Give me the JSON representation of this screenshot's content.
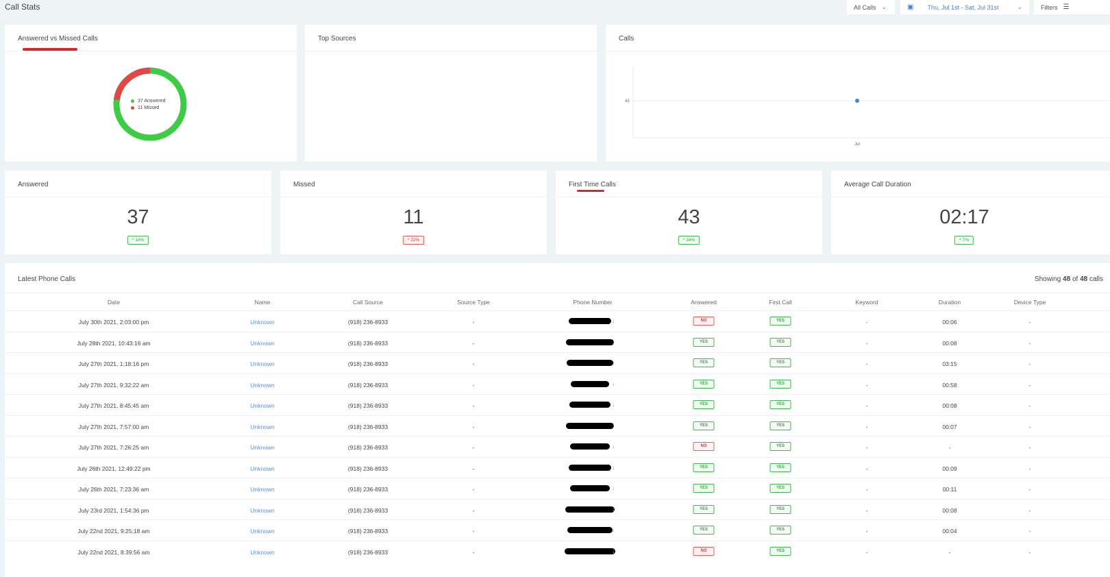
{
  "header": {
    "title": "Call Stats",
    "call_filter": "All Calls",
    "date_range": "Thu, Jul 1st - Sat, Jul 31st",
    "filters_label": "Filters"
  },
  "donut_card": {
    "title": "Answered vs Missed Calls",
    "legend": [
      {
        "label": "37 Answered",
        "color": "#3ecb45"
      },
      {
        "label": "11 Missed",
        "color": "#e04848"
      }
    ]
  },
  "sources_card": {
    "title": "Top Sources"
  },
  "calls_card": {
    "title": "Calls"
  },
  "chart_data": {
    "type": "scatter",
    "title": "",
    "categories": [
      "Jul"
    ],
    "series": [
      {
        "values": [
          43
        ]
      }
    ],
    "ytick_labels": [
      "43"
    ],
    "xtick_labels": [
      "Jul"
    ],
    "grid": true
  },
  "stats": [
    {
      "title": "Answered",
      "value": "37",
      "change": "^ 16%",
      "trend": "up"
    },
    {
      "title": "Missed",
      "value": "11",
      "change": "^ 22%",
      "trend": "down"
    },
    {
      "title": "First Time Calls",
      "value": "43",
      "change": "^ 34%",
      "trend": "up"
    },
    {
      "title": "Average Call Duration",
      "value": "02:17",
      "change": "^ 7%",
      "trend": "up"
    }
  ],
  "table": {
    "title": "Latest Phone Calls",
    "showing_prefix": "Showing ",
    "showing_count": "48",
    "showing_mid": " of ",
    "showing_total": "48",
    "showing_suffix": " calls",
    "columns": [
      "Date",
      "Name",
      "Call Source",
      "Source Type",
      "Phone Number",
      "Answered",
      "First Call",
      "Keyword",
      "Duration",
      "Device Type"
    ],
    "rows": [
      {
        "date": "July 30th 2021, 2:03:00 pm",
        "name": "Unknown",
        "source": "(918) 236-8933",
        "source_type": "-",
        "answered": "NO",
        "first_call": "YES",
        "keyword": "-",
        "duration": "00:06",
        "device": "-"
      },
      {
        "date": "July 28th 2021, 10:43:16 am",
        "name": "Unknown",
        "source": "(918) 236-8933",
        "source_type": "-",
        "answered": "YES",
        "first_call": "YES",
        "keyword": "-",
        "duration": "00:08",
        "device": "-"
      },
      {
        "date": "July 27th 2021, 1:18:16 pm",
        "name": "Unknown",
        "source": "(918) 236-8933",
        "source_type": "-",
        "answered": "YES",
        "first_call": "YES",
        "keyword": "-",
        "duration": "03:15",
        "device": "-"
      },
      {
        "date": "July 27th 2021, 9:32:22 am",
        "name": "Unknown",
        "source": "(918) 236-8933",
        "source_type": "-",
        "answered": "YES",
        "first_call": "YES",
        "keyword": "-",
        "duration": "00:58",
        "device": "-"
      },
      {
        "date": "July 27th 2021, 8:45:45 am",
        "name": "Unknown",
        "source": "(918) 236-8933",
        "source_type": "-",
        "answered": "YES",
        "first_call": "YES",
        "keyword": "-",
        "duration": "00:08",
        "device": "-"
      },
      {
        "date": "July 27th 2021, 7:57:00 am",
        "name": "Unknown",
        "source": "(918) 236-8933",
        "source_type": "-",
        "answered": "YES",
        "first_call": "YES",
        "keyword": "-",
        "duration": "00:07",
        "device": "-"
      },
      {
        "date": "July 27th 2021, 7:26:25 am",
        "name": "Unknown",
        "source": "(918) 236-8933",
        "source_type": "-",
        "answered": "NO",
        "first_call": "YES",
        "keyword": "-",
        "duration": "-",
        "device": "-"
      },
      {
        "date": "July 26th 2021, 12:49:22 pm",
        "name": "Unknown",
        "source": "(918) 236-8933",
        "source_type": "-",
        "answered": "YES",
        "first_call": "YES",
        "keyword": "-",
        "duration": "00:09",
        "device": "-"
      },
      {
        "date": "July 26th 2021, 7:23:36 am",
        "name": "Unknown",
        "source": "(918) 236-8933",
        "source_type": "-",
        "answered": "YES",
        "first_call": "YES",
        "keyword": "-",
        "duration": "00:11",
        "device": "-"
      },
      {
        "date": "July 23rd 2021, 1:54:36 pm",
        "name": "Unknown",
        "source": "(918) 236-8933",
        "source_type": "-",
        "answered": "YES",
        "first_call": "YES",
        "keyword": "-",
        "duration": "00:08",
        "device": "-"
      },
      {
        "date": "July 22nd 2021, 9:25:18 am",
        "name": "Unknown",
        "source": "(918) 236-8933",
        "source_type": "-",
        "answered": "YES",
        "first_call": "YES",
        "keyword": "-",
        "duration": "00:04",
        "device": "-"
      },
      {
        "date": "July 22nd 2021, 8:39:56 am",
        "name": "Unknown",
        "source": "(918) 236-8933",
        "source_type": "-",
        "answered": "NO",
        "first_call": "YES",
        "keyword": "-",
        "duration": "-",
        "device": "-"
      }
    ]
  }
}
